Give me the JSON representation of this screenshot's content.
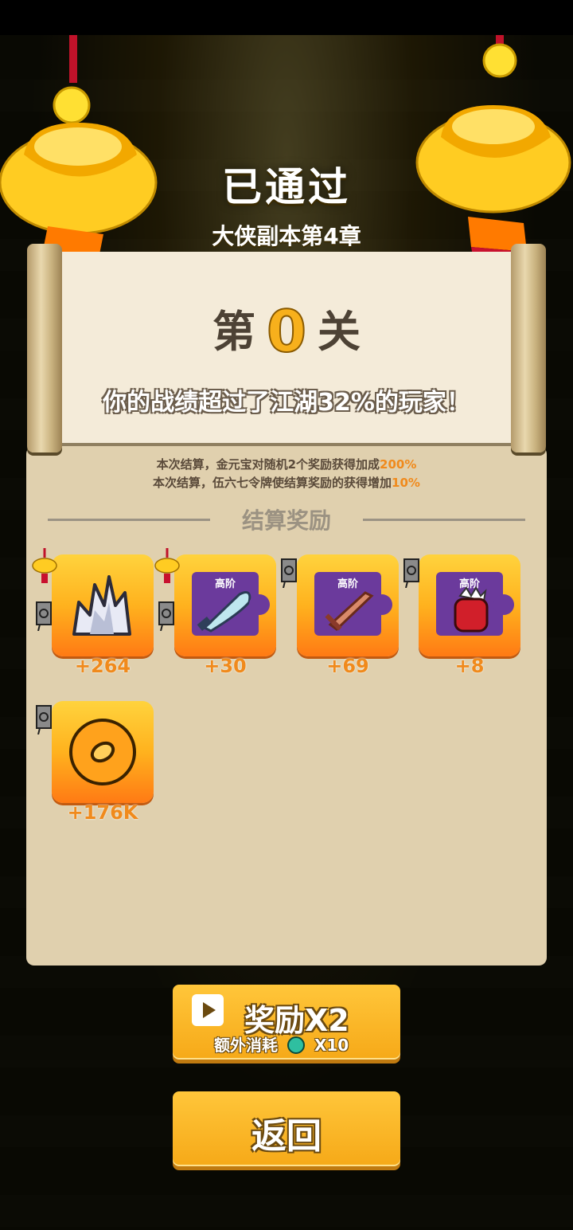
{
  "header": {
    "title": "已通过",
    "subtitle": "大侠副本第4章"
  },
  "scroll": {
    "stage_prefix": "第",
    "stage_number": "0",
    "stage_suffix": "关",
    "record_text": "你的战绩超过了江湖32%的玩家！"
  },
  "notes": {
    "line1_text": "本次结算，金元宝对随机2个奖励获得加成",
    "line1_value": "200%",
    "line2_text": "本次结算，伍六七令牌使结算奖励的获得增加",
    "line2_value": "10%"
  },
  "rewards_section": {
    "title": "结算奖励",
    "items": [
      {
        "icon": "crystal-icon",
        "amount": "+264",
        "tier": ""
      },
      {
        "icon": "blade-puzzle-icon",
        "amount": "+30",
        "tier": "高阶"
      },
      {
        "icon": "sword-puzzle-icon",
        "amount": "+69",
        "tier": "高阶"
      },
      {
        "icon": "glove-puzzle-icon",
        "amount": "+8",
        "tier": "高阶"
      },
      {
        "icon": "coin-icon",
        "amount": "+176K",
        "tier": ""
      }
    ]
  },
  "buttons": {
    "double_label": "奖励X2",
    "double_cost_label": "额外消耗",
    "double_cost_amount": "X10",
    "back_label": "返回"
  },
  "colors": {
    "accent_orange": "#f08a1c",
    "button_yellow": "#f6a918",
    "panel_bg": "#e0d0ae"
  }
}
